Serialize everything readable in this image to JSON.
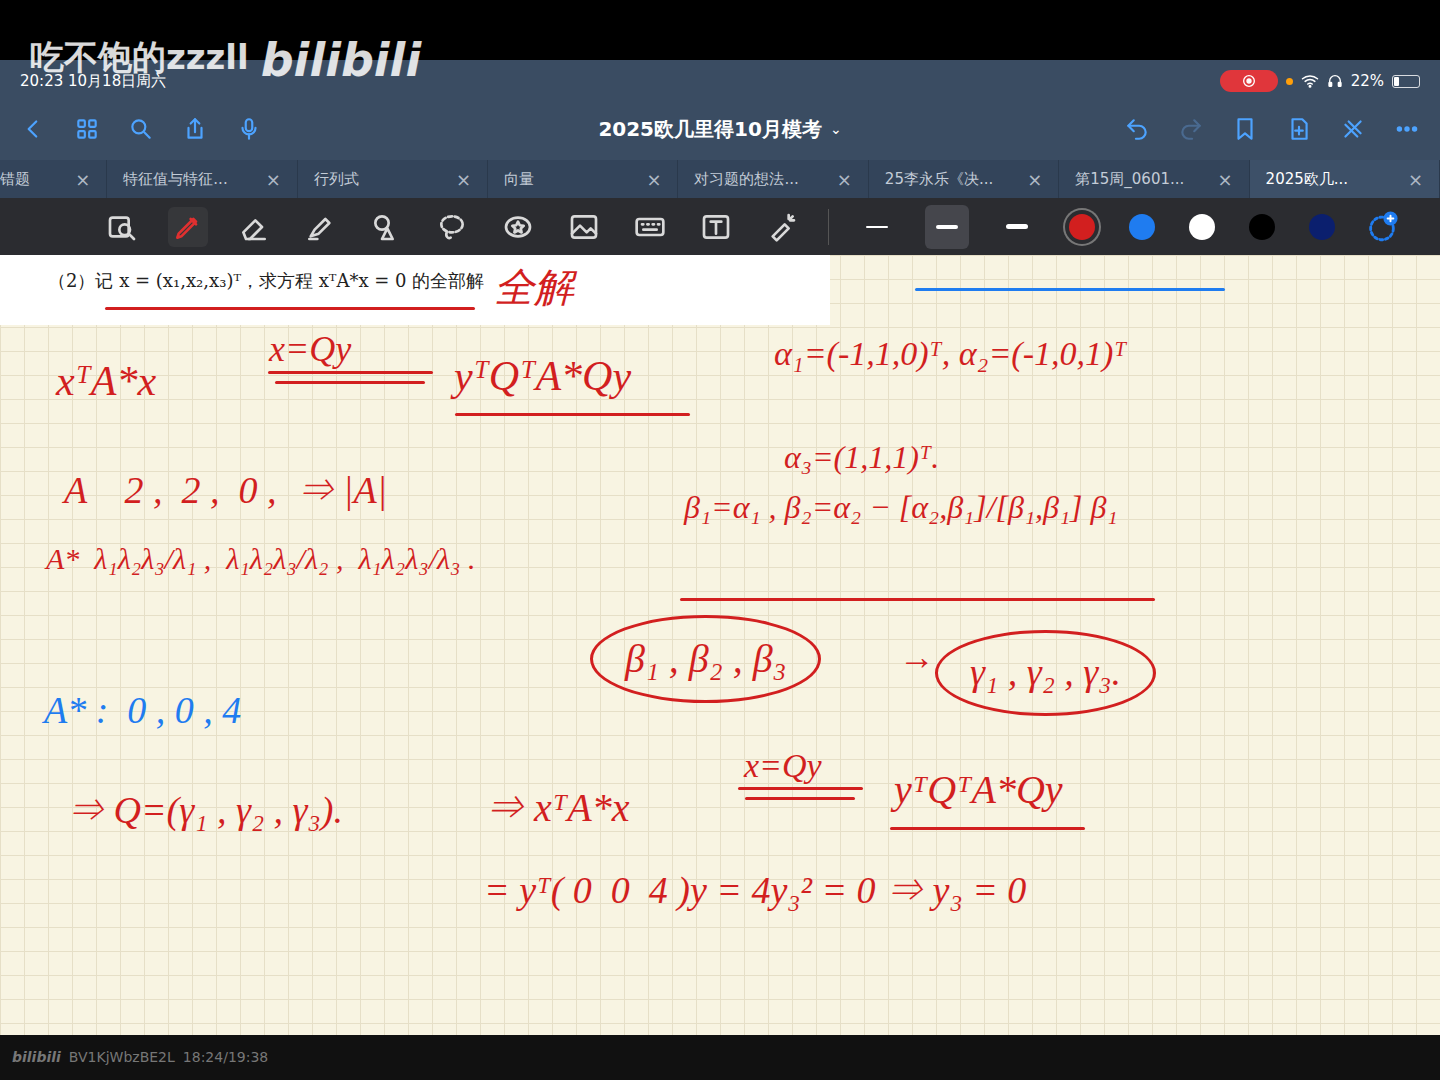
{
  "video": {
    "watermark": "吃不饱的zzzll",
    "platform": "bilibili",
    "footer_platform": "bilibili",
    "bv": "BV1KjWbzBE2L",
    "time": "18:24/19:38"
  },
  "status_bar": {
    "clock": "20:23 10月18日周六",
    "battery": "22%",
    "battery_level": 0.22,
    "recording": true
  },
  "window": {
    "title": "2025欧几里得10月模考",
    "title_caret": "⌄"
  },
  "tabs": [
    {
      "label": "错题",
      "selected": false,
      "close": "×"
    },
    {
      "label": "特征值与特征...",
      "selected": false,
      "close": "×"
    },
    {
      "label": "行列式",
      "selected": false,
      "close": "×"
    },
    {
      "label": "向量",
      "selected": false,
      "close": "×"
    },
    {
      "label": "对习题的想法...",
      "selected": false,
      "close": "×"
    },
    {
      "label": "25李永乐《决...",
      "selected": false,
      "close": "×"
    },
    {
      "label": "第15周_0601...",
      "selected": false,
      "close": "×"
    },
    {
      "label": "2025欧几...",
      "selected": true,
      "close": "×"
    }
  ],
  "toolbar": {
    "tools": [
      {
        "kind": "zoom",
        "selected": false
      },
      {
        "kind": "pen",
        "selected": true
      },
      {
        "kind": "eraser",
        "selected": false
      },
      {
        "kind": "highlighter",
        "selected": false
      },
      {
        "kind": "shapes",
        "selected": false
      },
      {
        "kind": "lasso",
        "selected": false
      },
      {
        "kind": "sticker",
        "selected": false
      },
      {
        "kind": "image",
        "selected": false
      },
      {
        "kind": "keyboard",
        "selected": false
      },
      {
        "kind": "text",
        "selected": false
      },
      {
        "kind": "laser",
        "selected": false
      }
    ],
    "widths": [
      {
        "selected": false
      },
      {
        "selected": true
      },
      {
        "selected": false
      }
    ],
    "colors": [
      {
        "color": "#d21f1f",
        "selected": true
      },
      {
        "color": "#1f7cf0",
        "selected": false
      },
      {
        "color": "#ffffff",
        "selected": false
      },
      {
        "color": "#000000",
        "selected": false
      },
      {
        "color": "#0b1f6e",
        "selected": false
      }
    ]
  },
  "document": {
    "question": "（2）记 x = (x₁,x₂,x₃)ᵀ，求方程 xᵀA*x = 0 的全部解",
    "notes": [
      {
        "text": "全解",
        "color": "#d21f1f",
        "circled": false
      },
      {
        "text": "xᵀA*x",
        "color": "#d21f1f",
        "circled": false
      },
      {
        "text": "x=Qy",
        "color": "#d21f1f",
        "circled": false
      },
      {
        "text": "yᵀQᵀA*Qy",
        "color": "#d21f1f",
        "circled": false
      },
      {
        "text": "α₁=(-1,1,0)ᵀ, α₂=(-1,0,1)ᵀ",
        "color": "#d21f1f",
        "circled": false
      },
      {
        "text": "α₃=(1,1,1)ᵀ.",
        "color": "#d21f1f",
        "circled": false
      },
      {
        "text": "A    2 ,  2 ,  0 ,  ⇒ |A|",
        "color": "#d21f1f",
        "circled": false
      },
      {
        "text": "A*  λ₁λ₂λ₃/λ₁ ,  λ₁λ₂λ₃/λ₂ ,  λ₁λ₂λ₃/λ₃ .",
        "color": "#d21f1f",
        "circled": false
      },
      {
        "text": "β₁=α₁ , β₂=α₂ − [α₂,β₁]/[β₁,β₁] β₁",
        "color": "#d21f1f",
        "circled": false
      },
      {
        "text": "β₁ , β₂ , β₃",
        "color": "#d21f1f",
        "circled": true
      },
      {
        "text": "→",
        "color": "#d21f1f",
        "circled": false
      },
      {
        "text": "γ₁ , γ₂ , γ₃.",
        "color": "#d21f1f",
        "circled": true
      },
      {
        "text": "A* :  0 , 0 , 4",
        "color": "#1f7cf0",
        "circled": false
      },
      {
        "text": "⇒ Q=(γ₁ , γ₂ , γ₃).",
        "color": "#d21f1f",
        "circled": false
      },
      {
        "text": "⇒ xᵀA*x",
        "color": "#d21f1f",
        "circled": false
      },
      {
        "text": "x=Qy",
        "color": "#d21f1f",
        "circled": false
      },
      {
        "text": "yᵀQᵀA*Qy",
        "color": "#d21f1f",
        "circled": false
      },
      {
        "text": "= yᵀ( 0  0  4 )y = 4y₃² = 0 ⇒ y₃ = 0",
        "color": "#d21f1f",
        "circled": false
      }
    ]
  }
}
